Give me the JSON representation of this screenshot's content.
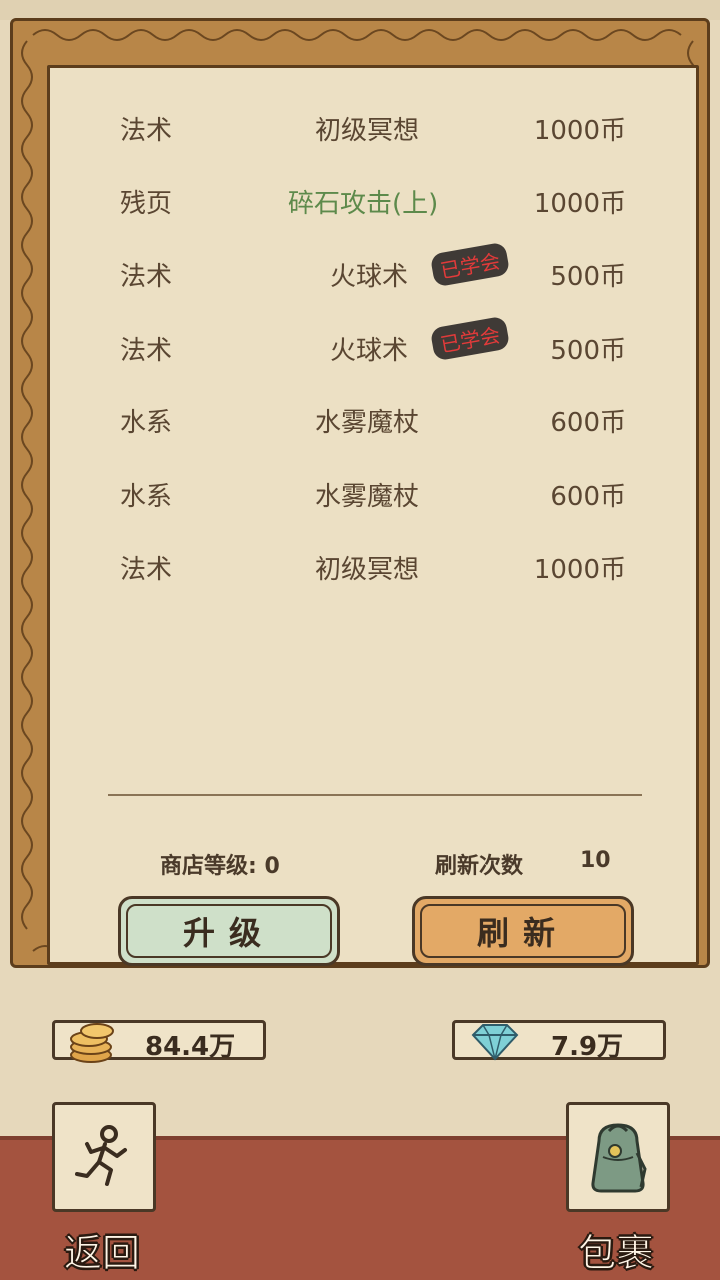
{
  "shop": {
    "items": [
      {
        "category": "法术",
        "name": "初级冥想",
        "price": "1000币",
        "learned": false,
        "highlight": false
      },
      {
        "category": "残页",
        "name": "碎石攻击(上)",
        "price": "1000币",
        "learned": false,
        "highlight": true
      },
      {
        "category": "法术",
        "name": "火球术",
        "price": "500币",
        "learned": true,
        "highlight": false
      },
      {
        "category": "法术",
        "name": "火球术",
        "price": "500币",
        "learned": true,
        "highlight": false
      },
      {
        "category": "水系",
        "name": "水雾魔杖",
        "price": "600币",
        "learned": false,
        "highlight": false
      },
      {
        "category": "水系",
        "name": "水雾魔杖",
        "price": "600币",
        "learned": false,
        "highlight": false
      },
      {
        "category": "法术",
        "name": "初级冥想",
        "price": "1000币",
        "learned": false,
        "highlight": false
      }
    ],
    "learned_badge": "已学会",
    "shop_level_label": "商店等级: 0",
    "refresh_count_label": "刷新次数",
    "refresh_count_value": "10",
    "upgrade_button": "升级",
    "refresh_button": "刷新"
  },
  "currency": {
    "coins": "84.4万",
    "gems": "7.9万"
  },
  "nav": {
    "back_label": "返回",
    "bag_label": "包裹"
  },
  "icons": {
    "coins": "coin-stack-icon",
    "gems": "diamond-icon",
    "back": "running-man-icon",
    "bag": "backpack-icon"
  },
  "colors": {
    "panel_bg": "#ece0c4",
    "frame": "#b88648",
    "highlight_text": "#5d8a4b",
    "badge_text": "#e23a3a",
    "upgrade_btn": "#cfe0c9",
    "refresh_btn": "#e3a966",
    "bottom_band": "#a4533f"
  }
}
